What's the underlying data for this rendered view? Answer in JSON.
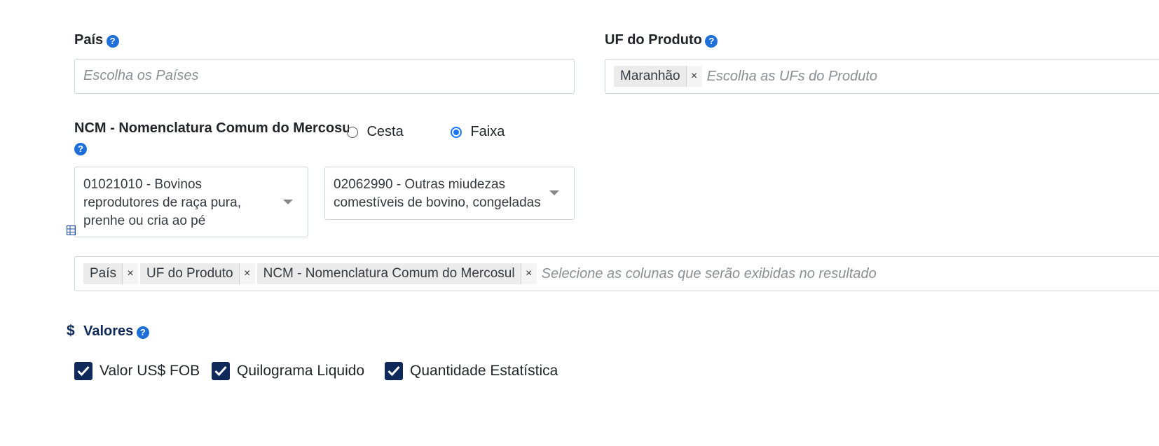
{
  "pais": {
    "label": "País",
    "placeholder": "Escolha os Países"
  },
  "uf": {
    "label": "UF do Produto",
    "chips": [
      "Maranhão"
    ],
    "placeholder": "Escolha as UFs do Produto"
  },
  "ncm": {
    "label": "NCM - Nomenclatura Comum do Mercosul",
    "radio_options": [
      {
        "label": "Cesta",
        "checked": false
      },
      {
        "label": "Faixa",
        "checked": true
      }
    ],
    "range_start": "01021010 - Bovinos reprodutores de raça pura, prenhe ou cria ao pé",
    "range_end": "02062990 - Outras miudezas comestíveis de bovino, congeladas"
  },
  "columns": {
    "chips": [
      "País",
      "UF do Produto",
      "NCM - Nomenclatura Comum do Mercosul"
    ],
    "placeholder": "Selecione as colunas que serão exibidas no resultado",
    "icon": "table-icon"
  },
  "valores": {
    "icon_symbol": "$",
    "title": "Valores",
    "checkboxes": [
      {
        "label": "Valor US$ FOB",
        "checked": true
      },
      {
        "label": "Quilograma Liquido",
        "checked": true
      },
      {
        "label": "Quantidade Estatística",
        "checked": true
      }
    ]
  },
  "help_glyph": "?",
  "chip_remove_glyph": "×",
  "colors": {
    "accent": "#1e6fd9",
    "checkbox": "#0f2a5a",
    "radio": "#1976ff",
    "heading": "#0f2a5a"
  }
}
